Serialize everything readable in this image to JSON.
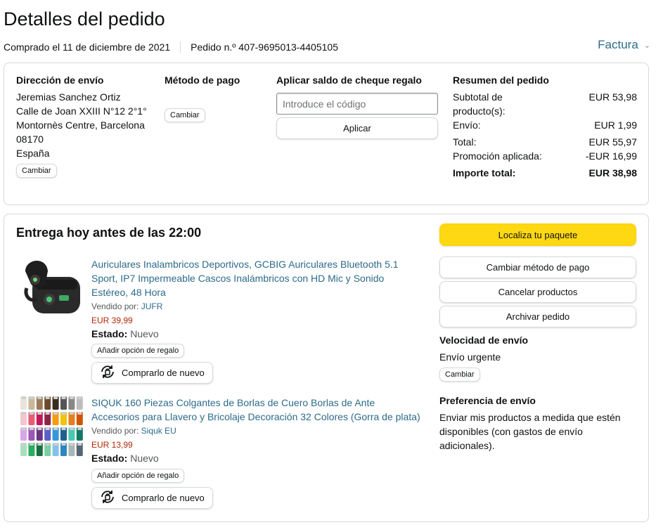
{
  "header": {
    "title": "Detalles del pedido",
    "purchased": "Comprado el 11 de diciembre de 2021",
    "order_number": "Pedido n.º 407-9695013-4405105",
    "invoice_label": "Factura"
  },
  "shipping": {
    "heading": "Dirección de envío",
    "lines": [
      "Jeremias Sanchez Ortiz",
      "Calle de Joan XXIII N°12 2°1°",
      "Montornès Centre, Barcelona",
      "08170",
      "España"
    ],
    "change_label": "Cambiar"
  },
  "payment": {
    "heading": "Método de pago",
    "change_label": "Cambiar"
  },
  "gift": {
    "heading": "Aplicar saldo de cheque regalo",
    "placeholder": "Introduce el código",
    "apply_label": "Aplicar"
  },
  "summary": {
    "heading": "Resumen del pedido",
    "rows": [
      {
        "label": "Subtotal de producto(s):",
        "value": "EUR 53,98"
      },
      {
        "label": "Envío:",
        "value": "EUR 1,99"
      },
      {
        "label": "Total:",
        "value": "EUR 55,97"
      },
      {
        "label": "Promoción aplicada:",
        "value": "-EUR 16,99"
      },
      {
        "label": "Importe total:",
        "value": "EUR 38,98"
      }
    ]
  },
  "delivery": {
    "heading": "Entrega hoy antes de las 22:00",
    "items": [
      {
        "title": "Auriculares Inalambricos Deportivos, GCBIG Auriculares Bluetooth 5.1 Sport, IP7 Impermeable Cascos Inalámbricos con HD Mic y Sonido Estéreo, 48 Hora",
        "sold_by_label": "Vendido por:",
        "seller": "JUFR",
        "price": "EUR 39,99",
        "state_label": "Estado:",
        "state": "Nuevo",
        "gift_label": "Añadir opción de regalo",
        "buy_again_label": "Comprarlo de nuevo"
      },
      {
        "title": "SIQUK 160 Piezas Colgantes de Borlas de Cuero Borlas de Ante Accesorios para Llavero y Bricolaje Decoración 32 Colores (Gorra de plata)",
        "sold_by_label": "Vendido por:",
        "seller": "Siquk EU",
        "price": "EUR 13,99",
        "state_label": "Estado:",
        "state": "Nuevo",
        "gift_label": "Añadir opción de regalo",
        "buy_again_label": "Comprarlo de nuevo"
      }
    ]
  },
  "actions": {
    "track": "Localiza tu paquete",
    "change_payment": "Cambiar método de pago",
    "cancel": "Cancelar productos",
    "archive": "Archivar pedido"
  },
  "shipping_speed": {
    "heading": "Velocidad de envío",
    "value": "Envío urgente",
    "change_label": "Cambiar"
  },
  "shipping_pref": {
    "heading": "Preferencia de envío",
    "value": "Enviar mis productos a medida que estén disponibles (con gastos de envío adicionales)."
  },
  "colors": {
    "link": "#2c6b8a",
    "price": "#b12704",
    "primary_button": "#ffd814"
  }
}
